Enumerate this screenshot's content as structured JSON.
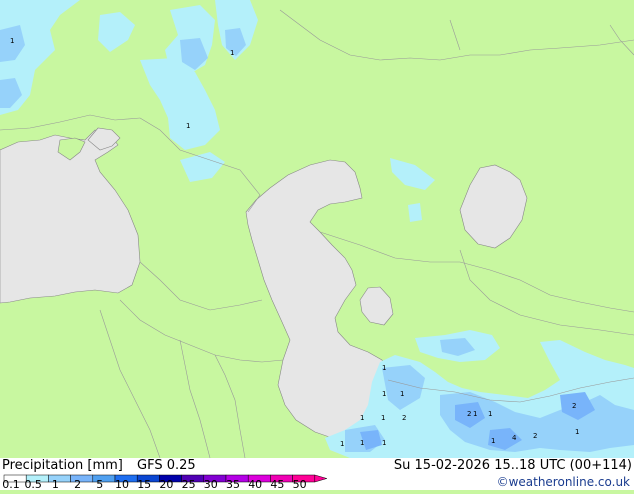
{
  "legend": {
    "title": "Precipitation [mm]",
    "model": "GFS 0.25",
    "valid": "Su 15-02-2026 15..18 UTC (00+114)",
    "credit": "©weatheronline.co.uk",
    "scale_labels": [
      "0.1",
      "0.5",
      "1",
      "2",
      "5",
      "10",
      "15",
      "20",
      "25",
      "30",
      "35",
      "40",
      "45",
      "50"
    ],
    "scale_colors": [
      "#ffffff",
      "#b4f0fa",
      "#96d2fa",
      "#78b4fa",
      "#50a0f0",
      "#1e6ef0",
      "#0a46d2",
      "#0000aa",
      "#5000b4",
      "#8200d2",
      "#b400e6",
      "#dc00dc",
      "#f000b4",
      "#ff0096"
    ]
  },
  "colors": {
    "land": "#c8f7a0",
    "sea": "#e6e6e6",
    "precip_light": "#b4f0fa",
    "precip_moderate": "#96d2fa",
    "precip_heavy": "#78b4fa",
    "border": "#999999"
  },
  "map_labels": {
    "values": [
      "1",
      "1",
      "2",
      "1",
      "4",
      "1",
      "1",
      "1",
      "2",
      "2",
      "2",
      "1",
      "1",
      "1",
      "1",
      "1",
      "1",
      "1",
      "1",
      "1"
    ]
  }
}
